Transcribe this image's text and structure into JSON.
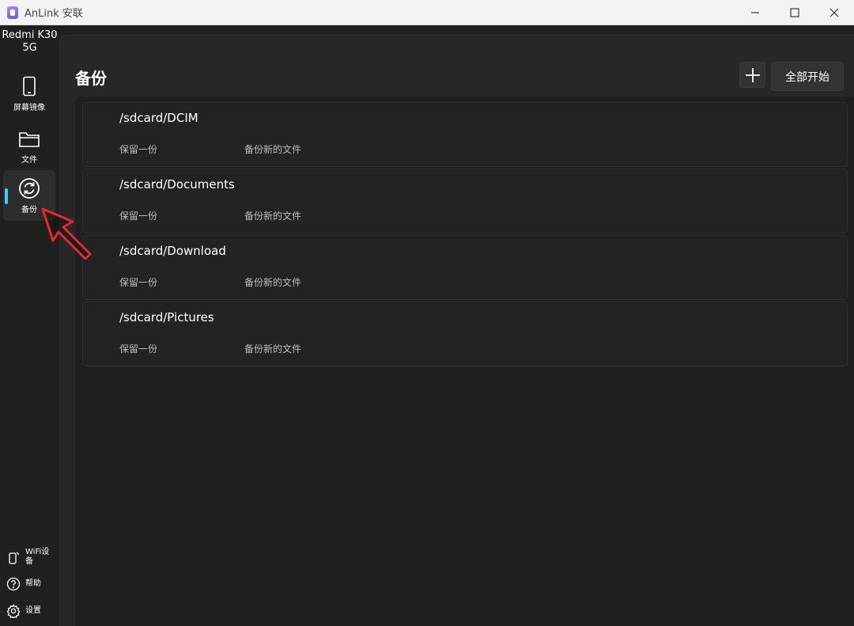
{
  "window": {
    "title": "AnLink 安联",
    "app_icon": "anlink-logo-icon",
    "controls": [
      "minimize-icon",
      "maximize-icon",
      "close-icon"
    ]
  },
  "sidebar": {
    "device_name": "Redmi K30 5G",
    "items": [
      {
        "label": "屏幕镜像",
        "icon": "phone-icon"
      },
      {
        "label": "文件",
        "icon": "folder-icon"
      },
      {
        "label": "备份",
        "icon": "sync-icon",
        "active": true
      }
    ],
    "bottom_items": [
      {
        "label": "WiFi设备",
        "icon": "wifi-phone-icon"
      },
      {
        "label": "帮助",
        "icon": "help-icon"
      },
      {
        "label": "设置",
        "icon": "gear-icon"
      }
    ]
  },
  "page": {
    "title": "备份",
    "add_button_icon": "plus-icon",
    "start_all_label": "全部开始"
  },
  "backups": [
    {
      "path": "/sdcard/DCIM",
      "retention": "保留一份",
      "mode": "备份新的文件"
    },
    {
      "path": "/sdcard/Documents",
      "retention": "保留一份",
      "mode": "备份新的文件"
    },
    {
      "path": "/sdcard/Download",
      "retention": "保留一份",
      "mode": "备份新的文件"
    },
    {
      "path": "/sdcard/Pictures",
      "retention": "保留一份",
      "mode": "备份新的文件"
    }
  ],
  "colors": {
    "accent": "#4cc2ff",
    "annotation_arrow": "#e8262b"
  }
}
